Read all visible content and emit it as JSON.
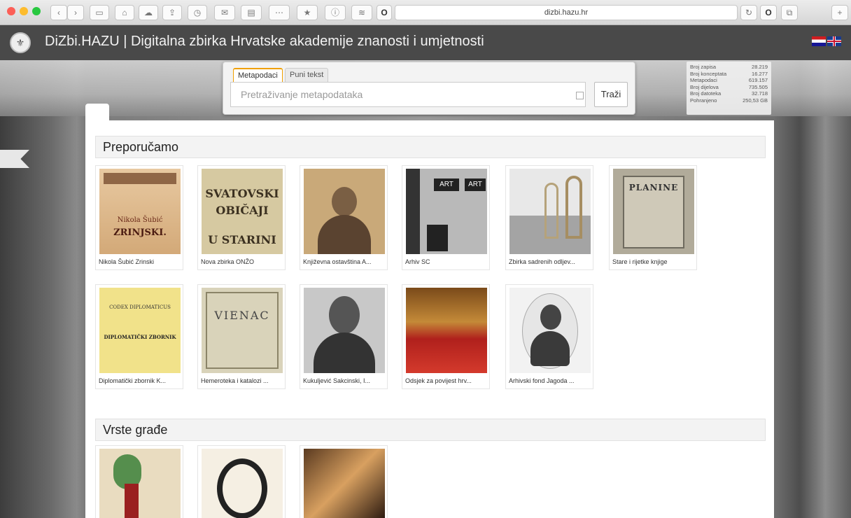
{
  "browser": {
    "url": "dizbi.hazu.hr"
  },
  "site": {
    "title": "DiZbi.HAZU | Digitalna zbirka Hrvatske akademije znanosti i umjetnosti"
  },
  "search": {
    "tabs": [
      "Metapodaci",
      "Puni tekst"
    ],
    "placeholder": "Pretraživanje metapodataka",
    "button_label": "Traži"
  },
  "stats": [
    {
      "label": "Broj zapisa",
      "value": "28.219"
    },
    {
      "label": "Broj konceptata",
      "value": "16.277"
    },
    {
      "label": "Metapodaci",
      "value": "619.157"
    },
    {
      "label": "Broj dijelova",
      "value": "735.505"
    },
    {
      "label": "Broj datoteka",
      "value": "32.718"
    },
    {
      "label": "Pohranjeno",
      "value": "250,53 GB"
    }
  ],
  "recommended": {
    "heading": "Preporučamo",
    "items": [
      {
        "caption": "Nikola Šubić Zrinski",
        "thumb": [
          "Nikola Šubić",
          "ZRINJSKI."
        ]
      },
      {
        "caption": "Nova zbirka ONŽO",
        "thumb": [
          "SVATOVSKI",
          "OBIČAJI",
          "U STARINI"
        ]
      },
      {
        "caption": "Književna ostavština A...",
        "thumb": []
      },
      {
        "caption": "Arhiv SC",
        "thumb": [
          "ART",
          "ART"
        ]
      },
      {
        "caption": "Zbirka sadrenih odljev...",
        "thumb": []
      },
      {
        "caption": "Stare i rijetke knjige",
        "thumb": [
          "PLANINE"
        ]
      },
      {
        "caption": "Diplomatički zbornik K...",
        "thumb": [
          "CODEX DIPLOMATICUS",
          "DIPLOMATIČKI ZBORNIK"
        ]
      },
      {
        "caption": "Hemeroteka i katalozi ...",
        "thumb": [
          "VIENAC"
        ]
      },
      {
        "caption": "Kukuljević Sakcinski, I...",
        "thumb": []
      },
      {
        "caption": "Odsjek za povijest hrv...",
        "thumb": []
      },
      {
        "caption": "Arhivski fond Jagoda ...",
        "thumb": []
      }
    ]
  },
  "types": {
    "heading": "Vrste građe"
  }
}
